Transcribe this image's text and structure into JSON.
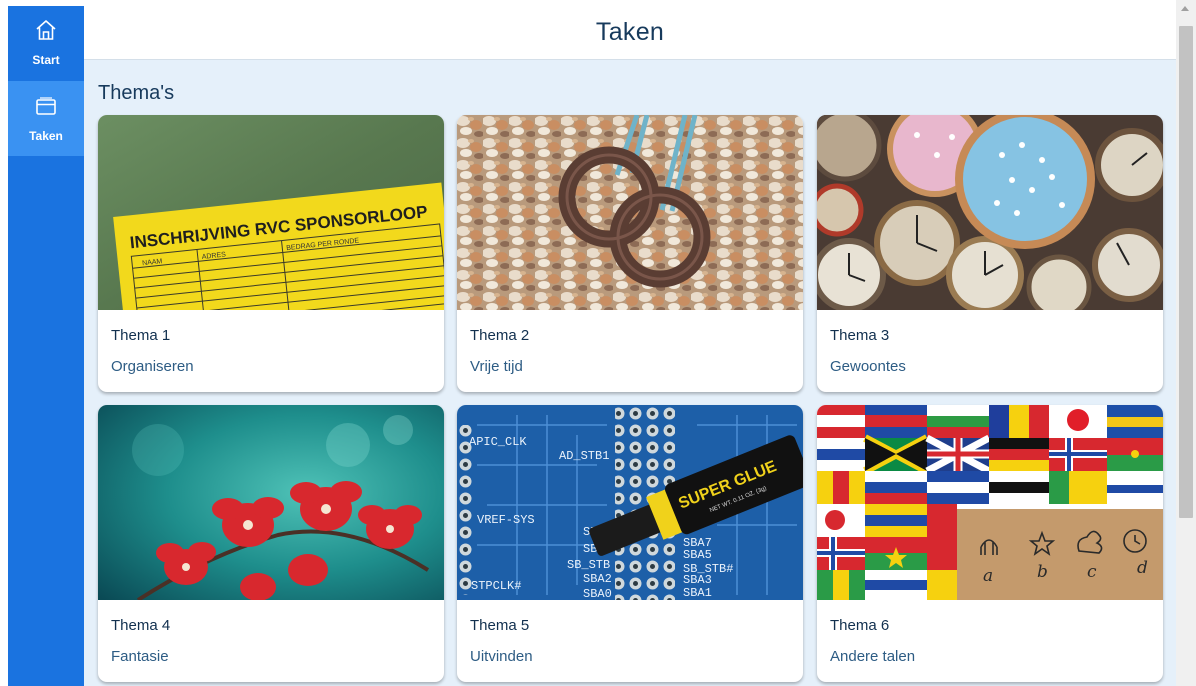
{
  "nav": {
    "items": [
      {
        "label": "Start",
        "icon": "home-icon"
      },
      {
        "label": "Taken",
        "icon": "windows-icon",
        "active": true
      }
    ]
  },
  "header": {
    "title": "Taken"
  },
  "main": {
    "section_title": "Thema's",
    "cards": [
      {
        "title": "Thema 1",
        "subtitle": "Organiseren",
        "sign_text": "INSCHRIJVING RVC SPONSORLOOP",
        "columns": [
          "NAAM",
          "ADRES",
          "BEDRAG PER RONDE"
        ]
      },
      {
        "title": "Thema 2",
        "subtitle": "Vrije tijd"
      },
      {
        "title": "Thema 3",
        "subtitle": "Gewoontes"
      },
      {
        "title": "Thema 4",
        "subtitle": "Fantasie"
      },
      {
        "title": "Thema 5",
        "subtitle": "Uitvinden",
        "board_labels": [
          "APIC_CLK",
          "AD_STB1",
          "VREF-SYS",
          "STPCLK#",
          "SBA6",
          "SBA4",
          "SB_STB",
          "SBA2",
          "SBA0",
          "SBA7",
          "SBA5",
          "SB_STB#",
          "SBA3",
          "SBA1"
        ],
        "tube_label": "SUPER GLUE",
        "tube_small": "NET WT. 0.11 OZ. (3g)"
      },
      {
        "title": "Thema 6",
        "subtitle": "Andere talen",
        "letters": [
          "a",
          "b",
          "c",
          "d"
        ]
      }
    ]
  },
  "colors": {
    "nav": "#1a73e0",
    "nav_active": "#3a92f2",
    "main_bg": "#e5f0fa",
    "title": "#173a5c"
  }
}
